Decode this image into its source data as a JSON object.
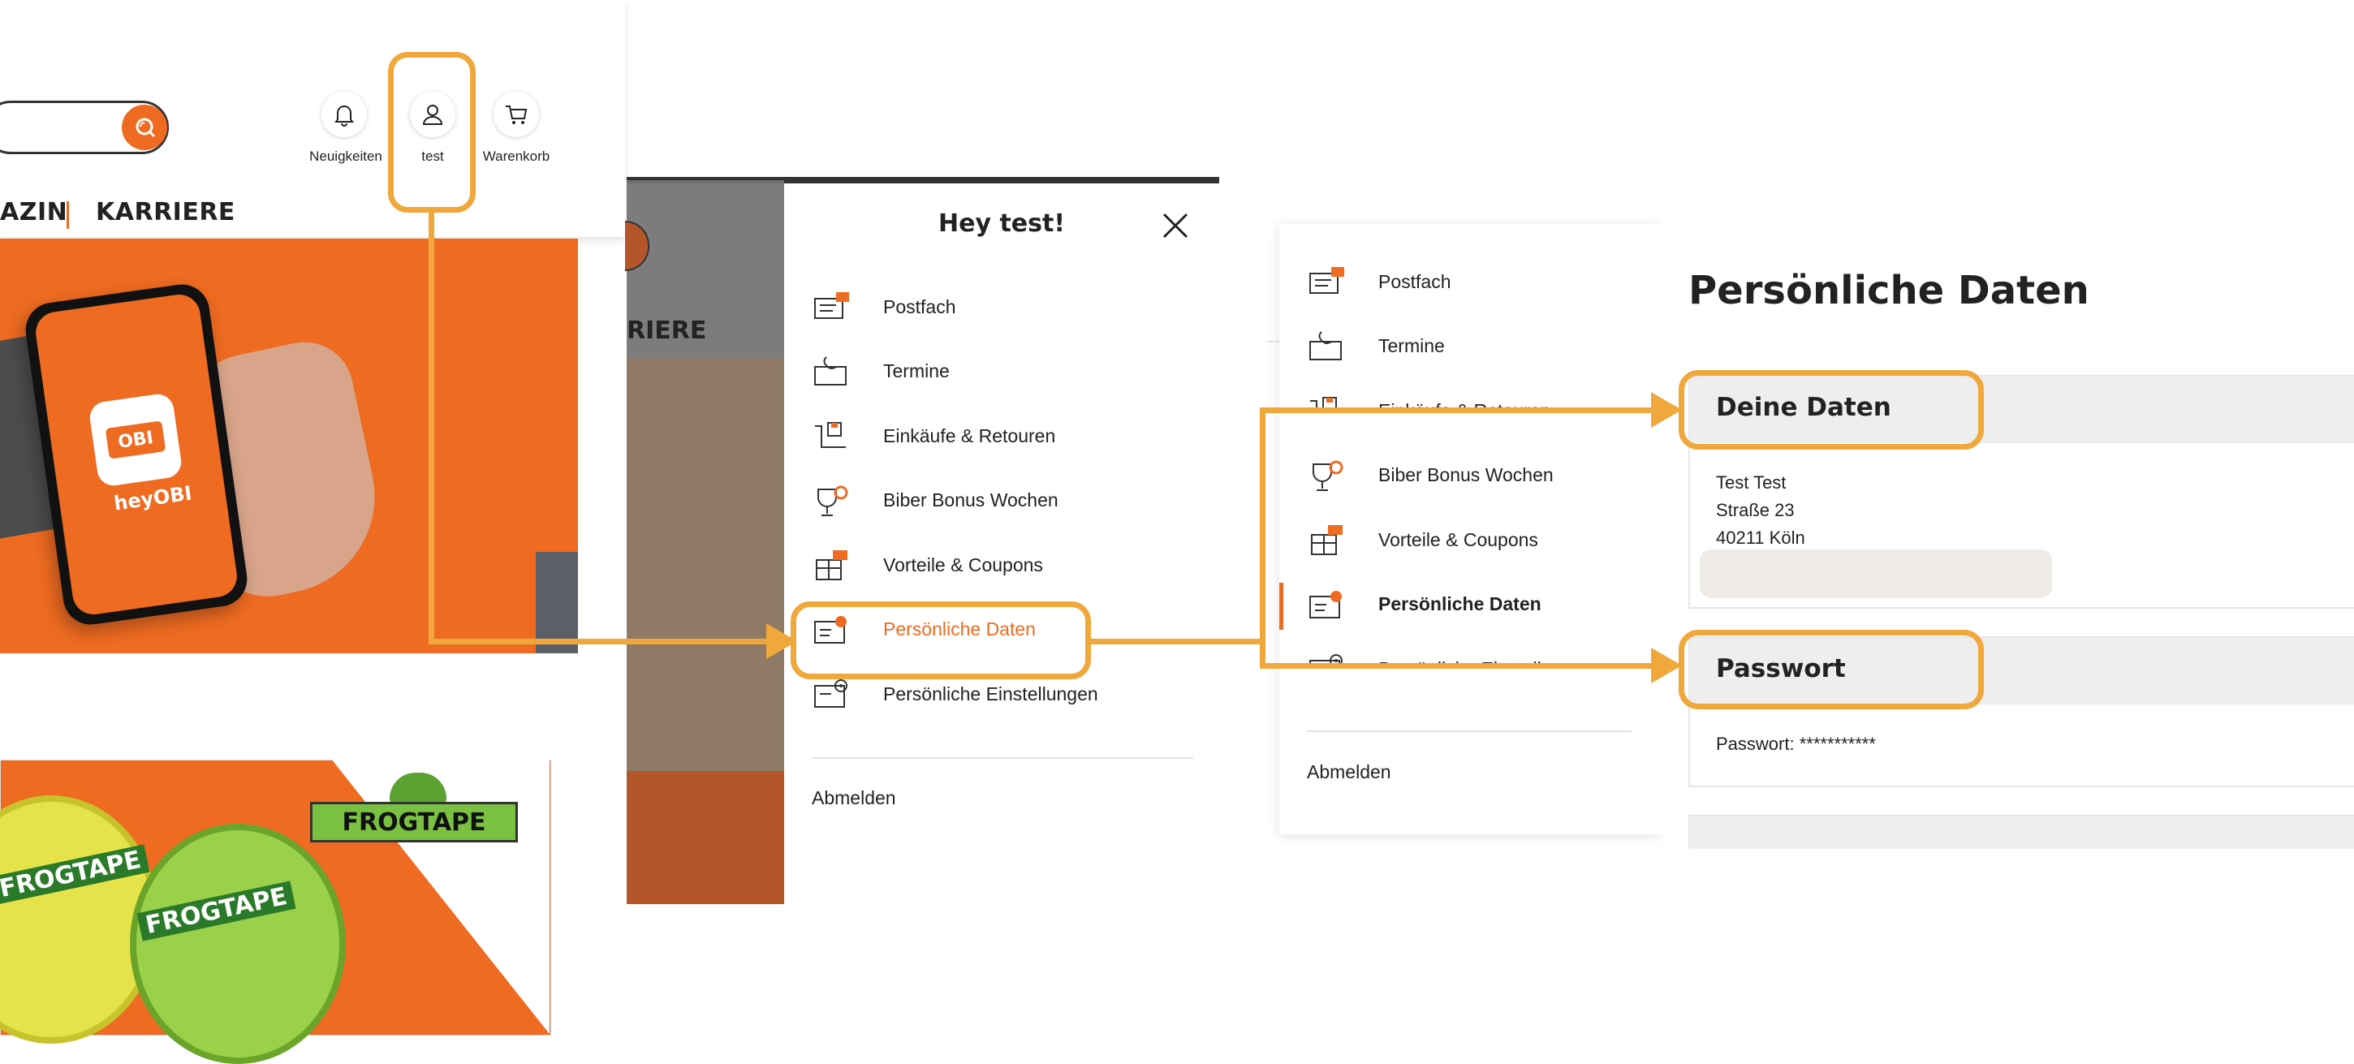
{
  "header": {
    "icons": [
      {
        "name": "bell-icon",
        "label": "Neuigkeiten"
      },
      {
        "name": "user-icon",
        "label": "test"
      },
      {
        "name": "cart-icon",
        "label": "Warenkorb"
      }
    ],
    "nav": {
      "item_partial": "AZIN",
      "item_careers": "KARRIERE"
    }
  },
  "hero": {
    "brand": "OBI",
    "app_name": "heyOBI"
  },
  "promo": {
    "brand": "FROGTAPE"
  },
  "panel2": {
    "nav_partial": "RIERE",
    "greeting": "Hey test!",
    "menu": [
      {
        "icon": "mailbox-icon",
        "label": "Postfach"
      },
      {
        "icon": "appointment-icon",
        "label": "Termine"
      },
      {
        "icon": "purchases-icon",
        "label": "Einkäufe & Retouren"
      },
      {
        "icon": "trophy-icon",
        "label": "Biber Bonus Wochen"
      },
      {
        "icon": "gift-icon",
        "label": "Vorteile & Coupons"
      },
      {
        "icon": "personal-data-icon",
        "label": "Persönliche Daten"
      },
      {
        "icon": "settings-icon",
        "label": "Persönliche Einstellungen"
      }
    ],
    "logout": "Abmelden"
  },
  "panel3": {
    "menu": [
      {
        "icon": "mailbox-icon",
        "label": "Postfach"
      },
      {
        "icon": "appointment-icon",
        "label": "Termine"
      },
      {
        "icon": "purchases-icon",
        "label": "Einkäufe & Retouren"
      },
      {
        "icon": "trophy-icon",
        "label": "Biber Bonus Wochen"
      },
      {
        "icon": "gift-icon",
        "label": "Vorteile & Coupons"
      },
      {
        "icon": "personal-data-icon",
        "label": "Persönliche Daten"
      },
      {
        "icon": "settings-icon",
        "label": "Persönliche Einstellungen"
      }
    ],
    "logout": "Abmelden",
    "page_title": "Persönliche Daten",
    "your_data": {
      "title": "Deine Daten",
      "name": "Test Test",
      "street": "Straße 23",
      "city": "40211 Köln"
    },
    "password": {
      "title": "Passwort",
      "value": "Passwort: ***********"
    }
  },
  "colors": {
    "brand_orange": "#ee6b21",
    "highlight": "#f0a83c",
    "text": "#222222"
  }
}
